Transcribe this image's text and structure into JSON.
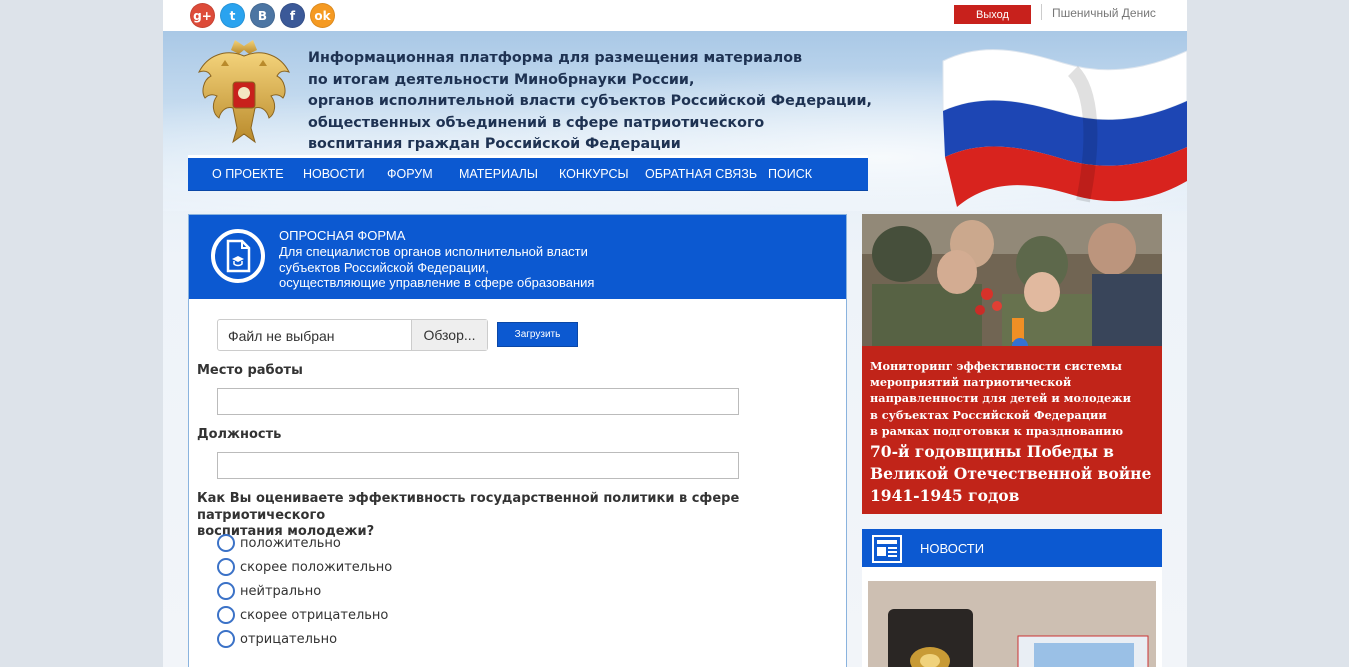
{
  "social": [
    {
      "icon": "google-plus-icon",
      "glyph": "g+",
      "color": "#dd4b39"
    },
    {
      "icon": "twitter-icon",
      "glyph": "t",
      "color": "#2aa3ef"
    },
    {
      "icon": "vk-icon",
      "glyph": "B",
      "color": "#4c75a3"
    },
    {
      "icon": "facebook-icon",
      "glyph": "f",
      "color": "#3b5998"
    },
    {
      "icon": "odnoklassniki-icon",
      "glyph": "ok",
      "color": "#f59a22"
    }
  ],
  "topbar": {
    "logout_label": "Выход",
    "username": "Пшеничный Денис"
  },
  "header": {
    "title_lines": [
      "Информационная платформа для размещения материалов",
      "по итогам деятельности Минобрнауки России,",
      "органов исполнительной власти субъектов Российской Федерации,",
      "общественных объединений в сфере патриотического",
      "воспитания граждан Российской Федерации"
    ]
  },
  "nav": {
    "items": [
      "О ПРОЕКТЕ",
      "НОВОСТИ",
      "ФОРУМ",
      "МАТЕРИАЛЫ",
      "КОНКУРСЫ",
      "ОБРАТНАЯ СВЯЗЬ",
      "ПОИСК"
    ]
  },
  "form": {
    "title": "ОПРОСНАЯ ФОРМА",
    "subtitle_lines": [
      "Для специалистов органов исполнительной власти",
      "субъектов Российской Федерации,",
      "осуществляющие управление в сфере образования"
    ],
    "file_text": "Файл не выбран",
    "browse_label": "Обзор...",
    "upload_label": "Загрузить",
    "workplace_label": "Место работы",
    "workplace_value": "",
    "position_label": "Должность",
    "position_value": "",
    "question_lines": [
      "Как Вы оцениваете эффективность государственной политики в сфере патриотического",
      "воспитания молодежи?"
    ],
    "options": [
      "положительно",
      "скорее положительно",
      "нейтрально",
      "скорее отрицательно",
      "отрицательно"
    ]
  },
  "promo": {
    "small_lines": [
      "Мониторинг эффективности системы",
      "мероприятий патриотической",
      "направленности для детей и молодежи",
      "в субъектах Российской Федерации",
      "в рамках подготовки к празднованию"
    ],
    "big_lines": [
      "70-й годовщины Победы в",
      "Великой Отечественной войне",
      "1941-1945 годов"
    ]
  },
  "news": {
    "label": "НОВОСТИ"
  },
  "colors": {
    "accent_blue": "#0c59d1",
    "promo_red": "#c12419",
    "logout_red": "#c8211c"
  }
}
